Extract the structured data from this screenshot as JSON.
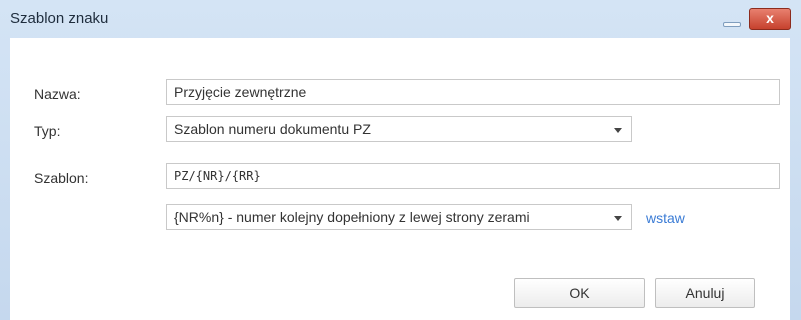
{
  "dialog": {
    "title": "Szablon znaku",
    "close_label": "x"
  },
  "form": {
    "name_label": "Nazwa:",
    "name_value": "Przyjęcie zewnętrzne",
    "type_label": "Typ:",
    "type_value": "Szablon numeru dokumentu PZ",
    "template_label": "Szablon:",
    "template_value": "PZ/{NR}/{RR}",
    "token_value": "{NR%n} - numer kolejny dopełniony z lewej strony zerami",
    "insert_link": "wstaw"
  },
  "buttons": {
    "ok_label": "OK",
    "cancel_label": "Anuluj"
  }
}
